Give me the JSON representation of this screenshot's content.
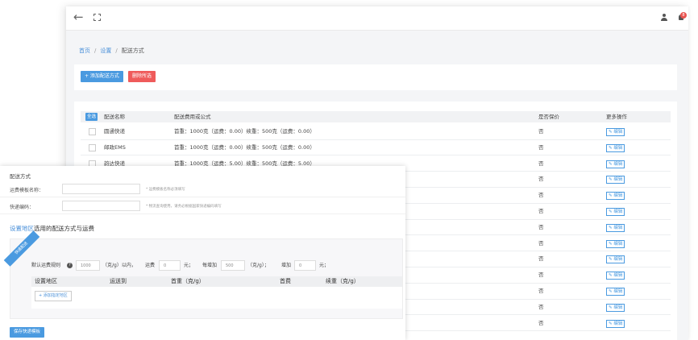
{
  "topbar": {
    "back_icon": "←",
    "badge_count": "8"
  },
  "breadcrumb": [
    "首页",
    "设置",
    "配送方式"
  ],
  "actions": {
    "add_label": "+ 添加配送方式",
    "delete_label": "删除所选"
  },
  "table": {
    "select_all": "全选",
    "headers": {
      "name": "配送名称",
      "formula": "配送费用或公式",
      "insured": "是否保价",
      "more": "更多操作"
    },
    "edit_label": "✎ 编辑",
    "rows": [
      {
        "name": "圆通快递",
        "formula": "首重：1000克（运费：0.00）续重：500克（运费：0.00）",
        "insured": "否"
      },
      {
        "name": "邮政EMS",
        "formula": "首重：1000克（运费：0.00）续重：500克（运费：0.00）",
        "insured": "否"
      },
      {
        "name": "韵达快递",
        "formula": "首重：1000克（运费：5.00）续重：500克（运费：5.00）",
        "insured": "否"
      },
      {
        "name": "",
        "formula": "",
        "insured": "否"
      },
      {
        "name": "",
        "formula": "",
        "insured": "否"
      },
      {
        "name": "",
        "formula": "",
        "insured": "否"
      },
      {
        "name": "",
        "formula": "",
        "insured": "否"
      },
      {
        "name": "",
        "formula": "",
        "insured": "否"
      },
      {
        "name": "",
        "formula": "",
        "insured": "否"
      },
      {
        "name": "",
        "formula": "",
        "insured": "否"
      },
      {
        "name": "",
        "formula": "",
        "insured": "否"
      },
      {
        "name": "",
        "formula": "",
        "insured": "否"
      },
      {
        "name": "",
        "formula": "",
        "insured": "否"
      }
    ]
  },
  "dialog": {
    "title": "配送方式",
    "template_label": "运费模板名称：",
    "template_hint": "* 运费模板名称必须填写",
    "code_label": "快递编码：",
    "code_hint": "* 物流查询使用，请务必根据国家快递编码填写",
    "region_title_link": "设置地区",
    "region_title_rest": "选用的配送方式与运费",
    "ribbon": "快递配送",
    "rule": {
      "label": "默认运费规则",
      "first_weight": "1000",
      "unit1": "（克/g）以内，",
      "fee_label": "运费",
      "fee_value": "0",
      "yuan1": "元；",
      "add_label": "每增加",
      "add_weight": "500",
      "unit2": "（克/g）；",
      "add_fee_label": "增加",
      "add_fee_value": "0",
      "yuan2": "元；"
    },
    "region_headers": {
      "area": "设置地区",
      "ship_to": "运送到",
      "first": "首重（克/g）",
      "first_fee": "首费",
      "cont": "续重（克/g）"
    },
    "add_region_label": "+ 添加指定地区",
    "save_label": "保存快递模板"
  }
}
